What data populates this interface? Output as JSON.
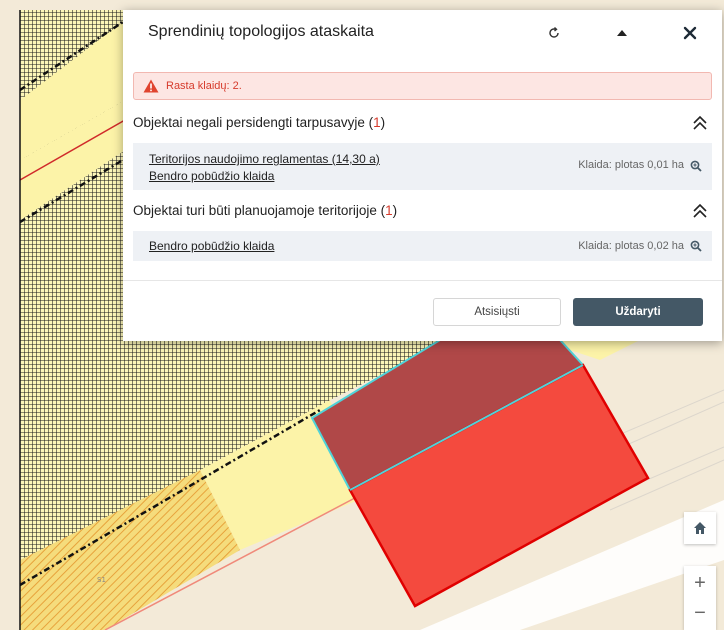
{
  "dialog": {
    "title": "Sprendinių topologijos ataskaita",
    "alert": "Rasta klaidų: 2.",
    "sections": [
      {
        "title": "Objektai negali persidengti tarpusavyje",
        "count": "1",
        "links": [
          "Teritorijos naudojimo reglamentas (14,30 a)",
          "Bendro pobūdžio klaida"
        ],
        "error": "Klaida: plotas 0,01 ha"
      },
      {
        "title": "Objektai turi būti planuojamoje teritorijoje",
        "count": "1",
        "links": [
          "Bendro pobūdžio klaida"
        ],
        "error": "Klaida: plotas 0,02 ha"
      }
    ],
    "buttons": {
      "download": "Atsisiųsti",
      "close": "Uždaryti"
    }
  },
  "map": {
    "label": "S1",
    "controls": {
      "zoom_in": "+",
      "zoom_out": "−"
    }
  },
  "colors": {
    "accent": "#445866",
    "error": "#d63b2c",
    "alert_bg": "#fde6e3",
    "zone_yellow": "#fcf3a8",
    "hatch_black": "#1a1a1a",
    "parcel_red": "#f44a3e",
    "parcel_dark": "#b04848",
    "overlap_cyan": "#4fd3d9"
  },
  "icons": [
    "refresh-icon",
    "collapse-up-icon",
    "close-icon",
    "warning-icon",
    "chevron-double-up-icon",
    "zoom-in-icon",
    "home-icon"
  ]
}
